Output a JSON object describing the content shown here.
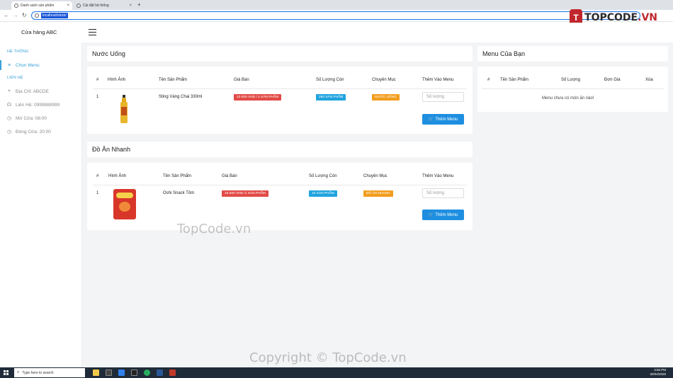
{
  "browser": {
    "tabs": [
      {
        "title": "Danh sách sản phẩm",
        "active": true
      },
      {
        "title": "Cài đặt hệ thống",
        "active": false
      }
    ],
    "url": "localhost/store/"
  },
  "brand": {
    "mark": "T",
    "name_main": "TOPCODE",
    "name_suffix": ".VN"
  },
  "header": {
    "store_name": "Cửa hàng ABC"
  },
  "sidebar": {
    "system_heading": "HỆ THỐNG",
    "menu_item": "Chọn Menu",
    "contact_heading": "LIÊN HỆ",
    "contacts": [
      {
        "icon": "location-icon",
        "text": "Địa Chỉ: ABCDE"
      },
      {
        "icon": "headset-icon",
        "text": "Liên Hệ: 0999888999"
      },
      {
        "icon": "clock-icon",
        "text": "Mở Cửa: 08:00"
      },
      {
        "icon": "clock-icon",
        "text": "Đóng Cửa: 20:00"
      }
    ]
  },
  "product_table_headers": [
    "#",
    "Hình Ảnh",
    "Tên Sản Phẩm",
    "Giá Bán",
    "Số Lượng Còn",
    "Chuyên Mục",
    "Thêm Vào Menu"
  ],
  "sections": [
    {
      "title": "Nước Uống",
      "rows": [
        {
          "index": "1",
          "image": "drink-bottle",
          "name": "Sting Vàng Chai 330ml",
          "price": "10.000 VND / 1 SẢN PHẨM",
          "stock": "260 SẢN PHẨM",
          "category": "NƯỚC UỐNG",
          "qty_placeholder": "Số lượng",
          "add_label": "Thêm Menu"
        }
      ]
    },
    {
      "title": "Đồ Ăn Nhanh",
      "rows": [
        {
          "index": "1",
          "image": "snack-bag",
          "name": "Oshi Snack Tôm",
          "price": "15.000 VND /1 SẢN PHẨM",
          "stock": "10 SẢN PHẨM",
          "category": "ĐỒ ĂN NHANH",
          "qty_placeholder": "Số lượng",
          "add_label": "Thêm Menu"
        }
      ]
    }
  ],
  "cart": {
    "title": "Menu Của Bạn",
    "headers": [
      "#",
      "Tên Sản Phẩm",
      "Số Lượng",
      "Đơn Giá",
      "Xóa"
    ],
    "empty_message": "Menu chưa có món ăn nào!"
  },
  "watermarks": {
    "middle": "TopCode.vn",
    "bottom": "Copyright © TopCode.vn"
  },
  "taskbar": {
    "search_placeholder": "Type here to search",
    "time": "3:56 PM",
    "date": "30/04/2025"
  },
  "colors": {
    "accent": "#3aa0d8",
    "price_badge": "#e24b47",
    "stock_badge": "#20a4df",
    "category_badge": "#f29d1e",
    "button": "#1e8fe0"
  }
}
